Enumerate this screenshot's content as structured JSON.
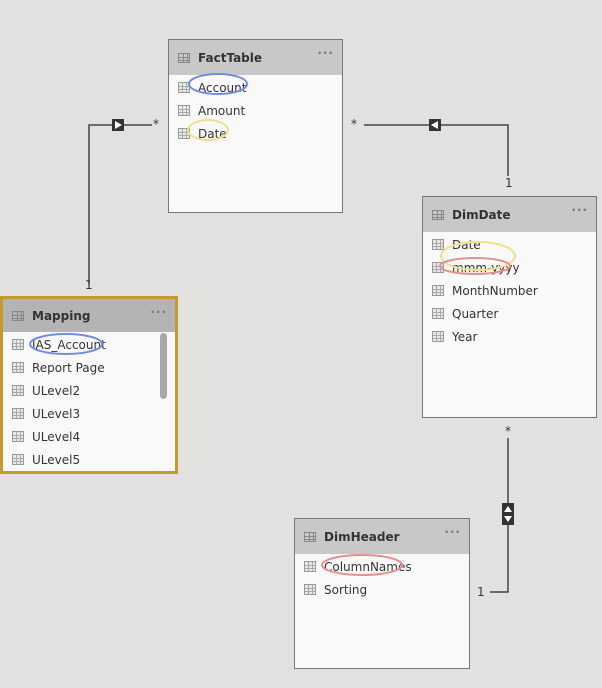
{
  "tables": {
    "fact": {
      "name": "FactTable",
      "more": "···",
      "columns": [
        "Account",
        "Amount",
        "Date"
      ]
    },
    "dimdate": {
      "name": "DimDate",
      "more": "···",
      "columns": [
        "Date",
        "mmm-yyyy",
        "MonthNumber",
        "Quarter",
        "Year"
      ]
    },
    "mapping": {
      "name": "Mapping",
      "more": "···",
      "columns": [
        "IAS_Account",
        "Report Page",
        "ULevel2",
        "ULevel3",
        "ULevel4",
        "ULevel5"
      ],
      "selected": true
    },
    "dimheader": {
      "name": "DimHeader",
      "more": "···",
      "columns": [
        "ColumnNames",
        "Sorting"
      ]
    }
  },
  "relationships": [
    {
      "from": "FactTable",
      "to": "Mapping",
      "many": "*",
      "one": "1",
      "direction": "single"
    },
    {
      "from": "FactTable",
      "to": "DimDate",
      "many": "*",
      "one": "1",
      "direction": "single"
    },
    {
      "from": "DimDate",
      "to": "DimHeader",
      "many": "*",
      "one": "1",
      "direction": "both"
    }
  ],
  "colors": {
    "selected_border": "#c49a2c",
    "highlight_blue": "#6f8fdc",
    "highlight_yellow": "#f3df8a",
    "highlight_red": "#e59090"
  }
}
